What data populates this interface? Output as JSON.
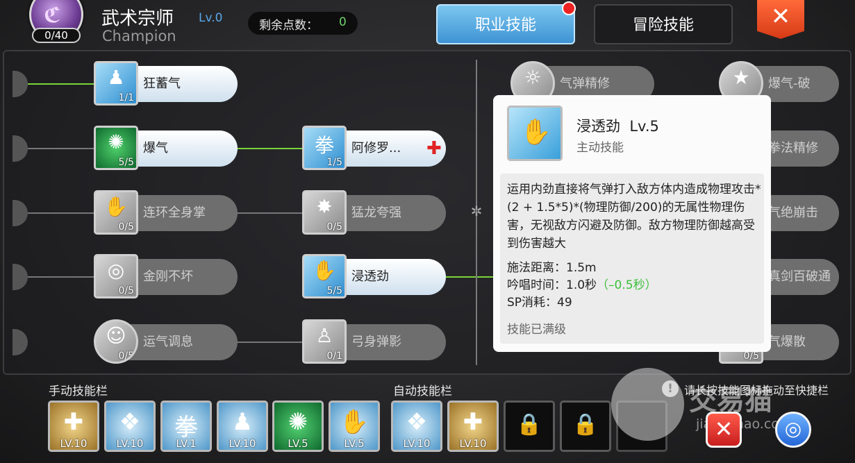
{
  "header": {
    "job_name": "武术宗师",
    "job_level": "Lv.0",
    "job_name_en": "Champion",
    "level_count": "0/40",
    "points_label": "剩余点数：",
    "points_value": "0",
    "tabs": [
      "职业技能",
      "冒险技能"
    ],
    "close_label": "✕"
  },
  "tree": {
    "left_col": [
      {
        "name": "狂蓄气",
        "count": "1/1",
        "state": "active"
      },
      {
        "name": "爆气",
        "count": "5/5",
        "state": "active"
      },
      {
        "name": "连环全身掌",
        "count": "0/5",
        "state": "locked"
      },
      {
        "name": "金刚不坏",
        "count": "0/5",
        "state": "locked"
      },
      {
        "name": "运气调息",
        "count": "0/5",
        "state": "locked"
      }
    ],
    "mid_col": [
      {
        "name": "阿修罗...",
        "count": "1/5",
        "state": "active",
        "icon_glyph": "拳"
      },
      {
        "name": "猛龙夸强",
        "count": "0/5",
        "state": "locked"
      },
      {
        "name": "浸透劲",
        "count": "5/5",
        "state": "active"
      },
      {
        "name": "弓身弹影",
        "count": "0/1",
        "state": "locked"
      }
    ],
    "right_col": [
      {
        "name": "气弹精修"
      },
      {
        "name": "爆气-破"
      },
      {
        "name": "拳法精修"
      },
      {
        "name": "气绝崩击"
      },
      {
        "name": "真剑百破通"
      },
      {
        "name": "气爆散"
      }
    ],
    "right_partial_count": "0/5"
  },
  "tooltip": {
    "name": "浸透劲",
    "level": "Lv.5",
    "type": "主动技能",
    "description": "运用内劲直接将气弹打入敌方体内造成物理攻击*(2 + 1.5*5)*(物理防御/200)的无属性物理伤害，无视敌方闪避及防御。敌方物理防御越高受到伤害越大",
    "cast_range": "施法距离：1.5m",
    "chant_time": "吟唱时间：1.0秒",
    "chant_bonus": "（–0.5秒）",
    "sp_cost": "SP消耗：49",
    "maxed": "技能已满级"
  },
  "bottom": {
    "manual_label": "手动技能栏",
    "auto_label": "自动技能栏",
    "manual_slots": [
      {
        "kind": "gold",
        "glyph": "✚",
        "lv": "LV.10"
      },
      {
        "kind": "blue",
        "glyph": "❖",
        "lv": "LV.10"
      },
      {
        "kind": "blue",
        "glyph": "拳",
        "lv": "LV.1"
      },
      {
        "kind": "blue",
        "glyph": "♟",
        "lv": "LV.10"
      },
      {
        "kind": "green",
        "glyph": "✺",
        "lv": "LV.5"
      },
      {
        "kind": "blue",
        "glyph": "✋",
        "lv": "LV.5"
      }
    ],
    "auto_slots": [
      {
        "kind": "blue",
        "glyph": "❖",
        "lv": "LV.10"
      },
      {
        "kind": "gold",
        "glyph": "✚",
        "lv": "LV.10"
      }
    ],
    "hint": "请长按技能图标拖动至快捷栏",
    "cancel_label": "✕",
    "confirm_label": "◎"
  },
  "watermark": {
    "cn": "交易猫",
    "en": "jiaoyimao.com"
  }
}
